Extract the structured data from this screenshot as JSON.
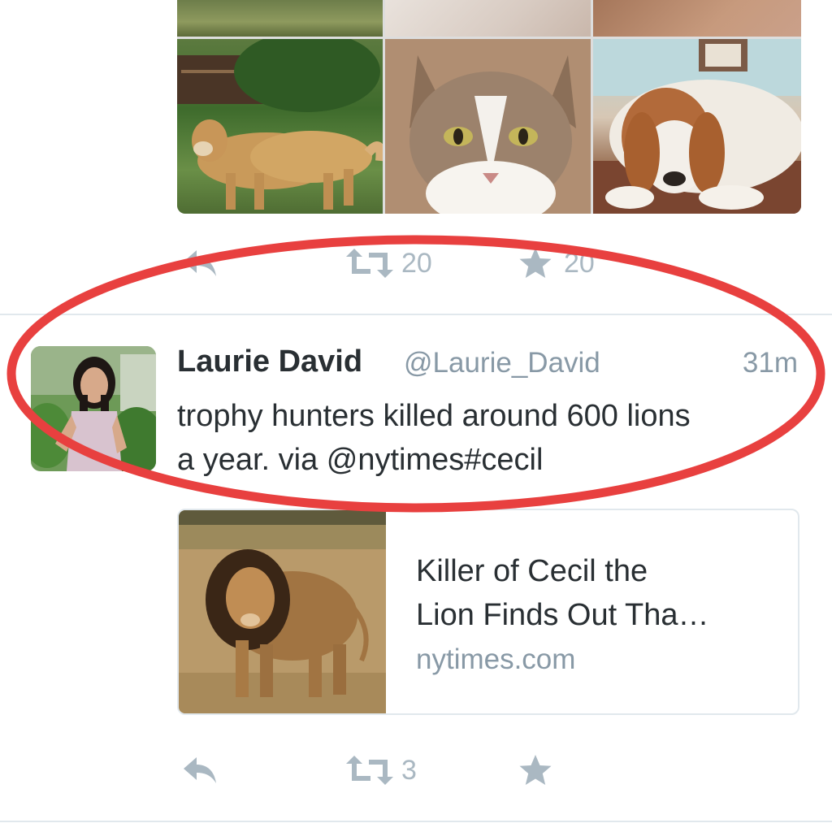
{
  "top_tweet": {
    "photos": [
      {
        "icon": "grass-photo"
      },
      {
        "icon": "paw-photo"
      },
      {
        "icon": "wood-photo"
      },
      {
        "icon": "golden-retriever-photo"
      },
      {
        "icon": "tabby-cat-photo"
      },
      {
        "icon": "beagle-photo"
      }
    ],
    "actions": {
      "retweet_count": "20",
      "favorite_count": "20"
    }
  },
  "tweet": {
    "author_name": "Laurie David",
    "author_handle": "@Laurie_David",
    "time": "31m",
    "text_line1": "trophy hunters killed around 600 lions",
    "text_line2": "a year. via @nytimes#cecil",
    "card": {
      "title_line1": "Killer of Cecil the",
      "title_line2": "Lion Finds Out Tha…",
      "domain": "nytimes.com",
      "image_icon": "lion-photo"
    },
    "actions": {
      "retweet_count": "3"
    }
  },
  "colors": {
    "icon_gray": "#aab8c2",
    "secondary_text": "#8899a6",
    "primary_text": "#292f33",
    "highlight_red": "#e8403f",
    "divider": "#e1e8ed"
  }
}
